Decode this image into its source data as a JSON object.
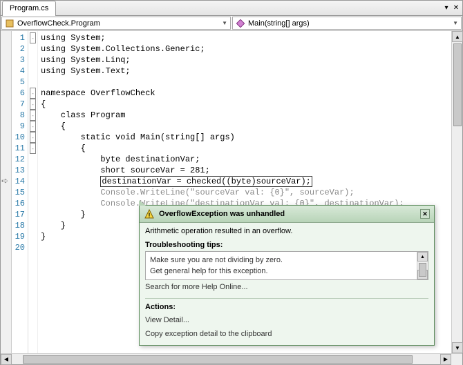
{
  "tab": {
    "title": "Program.cs"
  },
  "dropdowns": {
    "class": "OverflowCheck.Program",
    "method": "Main(string[] args)"
  },
  "code": {
    "lines": [
      "using System;",
      "using System.Collections.Generic;",
      "using System.Linq;",
      "using System.Text;",
      "",
      "namespace OverflowCheck",
      "{",
      "    class Program",
      "    {",
      "        static void Main(string[] args)",
      "        {",
      "            byte destinationVar;",
      "            short sourceVar = 281;",
      "            destinationVar = checked((byte)sourceVar);",
      "            Console.WriteLine(\"sourceVar val: {0}\", sourceVar);",
      "            Console.WriteLine(\"destinationVar val: {0}\", destinationVar);",
      "        }",
      "    }",
      "}",
      ""
    ],
    "highlight_line": 14,
    "current_line": 14
  },
  "exception": {
    "title": "OverflowException was unhandled",
    "message": "Arithmetic operation resulted in an overflow.",
    "tips_header": "Troubleshooting tips:",
    "tips": [
      "Make sure you are not dividing by zero.",
      "Get general help for this exception."
    ],
    "search_link": "Search for more Help Online...",
    "actions_header": "Actions:",
    "actions": [
      "View Detail...",
      "Copy exception detail to the clipboard"
    ]
  }
}
